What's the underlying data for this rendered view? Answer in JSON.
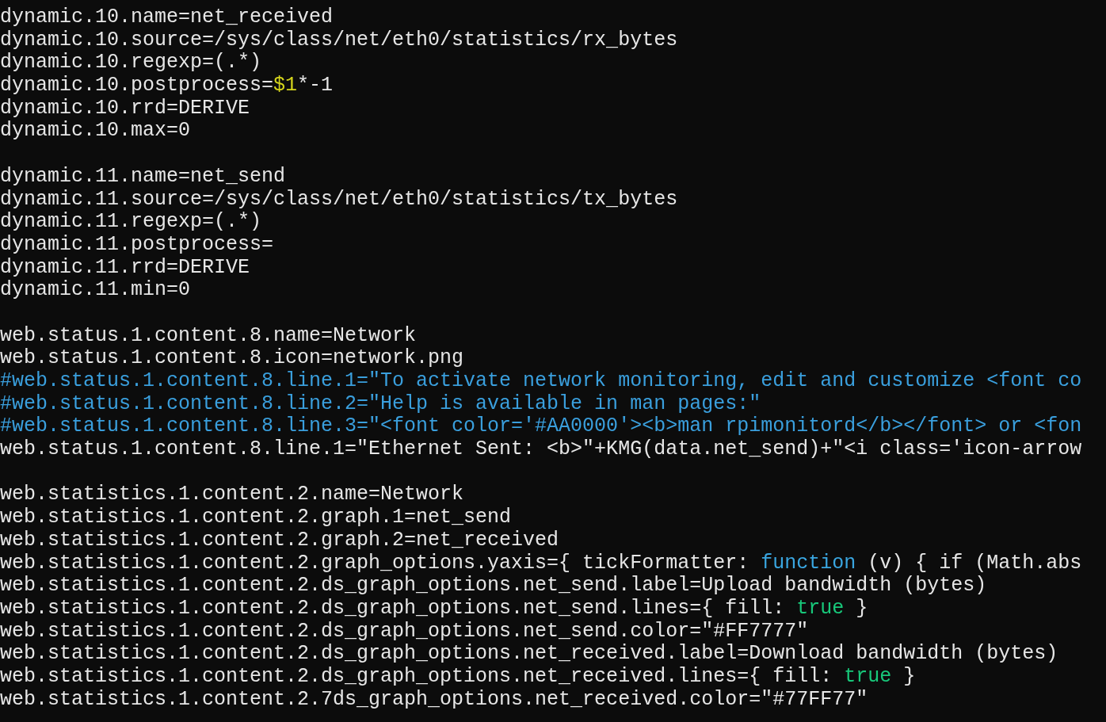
{
  "terminal": {
    "lines": [
      {
        "kind": "code",
        "segments": [
          {
            "kind": "plain",
            "text": "dynamic.10.name=net_received"
          }
        ]
      },
      {
        "kind": "code",
        "segments": [
          {
            "kind": "plain",
            "text": "dynamic.10.source=/sys/class/net/eth0/statistics/rx_bytes"
          }
        ]
      },
      {
        "kind": "code",
        "segments": [
          {
            "kind": "plain",
            "text": "dynamic.10.regexp=(.*)"
          }
        ]
      },
      {
        "kind": "code",
        "segments": [
          {
            "kind": "plain",
            "text": "dynamic.10.postprocess="
          },
          {
            "kind": "variable",
            "text": "$1"
          },
          {
            "kind": "plain",
            "text": "*-1"
          }
        ]
      },
      {
        "kind": "code",
        "segments": [
          {
            "kind": "plain",
            "text": "dynamic.10.rrd=DERIVE"
          }
        ]
      },
      {
        "kind": "code",
        "segments": [
          {
            "kind": "plain",
            "text": "dynamic.10.max=0"
          }
        ]
      },
      {
        "kind": "blank"
      },
      {
        "kind": "code",
        "segments": [
          {
            "kind": "plain",
            "text": "dynamic.11.name=net_send"
          }
        ]
      },
      {
        "kind": "code",
        "segments": [
          {
            "kind": "plain",
            "text": "dynamic.11.source=/sys/class/net/eth0/statistics/tx_bytes"
          }
        ]
      },
      {
        "kind": "code",
        "segments": [
          {
            "kind": "plain",
            "text": "dynamic.11.regexp=(.*)"
          }
        ]
      },
      {
        "kind": "code",
        "segments": [
          {
            "kind": "plain",
            "text": "dynamic.11.postprocess="
          }
        ]
      },
      {
        "kind": "code",
        "segments": [
          {
            "kind": "plain",
            "text": "dynamic.11.rrd=DERIVE"
          }
        ]
      },
      {
        "kind": "code",
        "segments": [
          {
            "kind": "plain",
            "text": "dynamic.11.min=0"
          }
        ]
      },
      {
        "kind": "blank"
      },
      {
        "kind": "code",
        "segments": [
          {
            "kind": "plain",
            "text": "web.status.1.content.8.name=Network"
          }
        ]
      },
      {
        "kind": "code",
        "segments": [
          {
            "kind": "plain",
            "text": "web.status.1.content.8.icon=network.png"
          }
        ]
      },
      {
        "kind": "comment",
        "segments": [
          {
            "kind": "comment",
            "text": "#web.status.1.content.8.line.1=\"To activate network monitoring, edit and customize <font co"
          }
        ]
      },
      {
        "kind": "comment",
        "segments": [
          {
            "kind": "comment",
            "text": "#web.status.1.content.8.line.2=\"Help is available in man pages:\""
          }
        ]
      },
      {
        "kind": "comment",
        "segments": [
          {
            "kind": "comment",
            "text": "#web.status.1.content.8.line.3=\"<font color='#AA0000'><b>man rpimonitord</b></font> or <fon"
          }
        ]
      },
      {
        "kind": "code",
        "segments": [
          {
            "kind": "plain",
            "text": "web.status.1.content.8.line.1=\"Ethernet Sent: <b>\"+KMG(data.net_send)+\"<i class='icon-arrow"
          }
        ]
      },
      {
        "kind": "blank"
      },
      {
        "kind": "code",
        "segments": [
          {
            "kind": "plain",
            "text": "web.statistics.1.content.2.name=Network"
          }
        ]
      },
      {
        "kind": "code",
        "segments": [
          {
            "kind": "plain",
            "text": "web.statistics.1.content.2.graph.1=net_send"
          }
        ]
      },
      {
        "kind": "code",
        "segments": [
          {
            "kind": "plain",
            "text": "web.statistics.1.content.2.graph.2=net_received"
          }
        ]
      },
      {
        "kind": "code",
        "segments": [
          {
            "kind": "plain",
            "text": "web.statistics.1.content.2.graph_options.yaxis={ tickFormatter: "
          },
          {
            "kind": "keyword",
            "text": "function"
          },
          {
            "kind": "plain",
            "text": " (v) { if (Math.abs"
          }
        ]
      },
      {
        "kind": "code",
        "segments": [
          {
            "kind": "plain",
            "text": "web.statistics.1.content.2.ds_graph_options.net_send.label=Upload bandwidth (bytes)"
          }
        ]
      },
      {
        "kind": "code",
        "segments": [
          {
            "kind": "plain",
            "text": "web.statistics.1.content.2.ds_graph_options.net_send.lines={ fill: "
          },
          {
            "kind": "boolean",
            "text": "true"
          },
          {
            "kind": "plain",
            "text": " }"
          }
        ]
      },
      {
        "kind": "code",
        "segments": [
          {
            "kind": "plain",
            "text": "web.statistics.1.content.2.ds_graph_options.net_send.color=\"#FF7777\""
          }
        ]
      },
      {
        "kind": "code",
        "segments": [
          {
            "kind": "plain",
            "text": "web.statistics.1.content.2.ds_graph_options.net_received.label=Download bandwidth (bytes)"
          }
        ]
      },
      {
        "kind": "code",
        "segments": [
          {
            "kind": "plain",
            "text": "web.statistics.1.content.2.ds_graph_options.net_received.lines={ fill: "
          },
          {
            "kind": "boolean",
            "text": "true"
          },
          {
            "kind": "plain",
            "text": " }"
          }
        ]
      },
      {
        "kind": "code",
        "segments": [
          {
            "kind": "plain",
            "text": "web.statistics.1.content.2.7ds_graph_options.net_received.color=\"#77FF77\""
          }
        ]
      }
    ]
  }
}
